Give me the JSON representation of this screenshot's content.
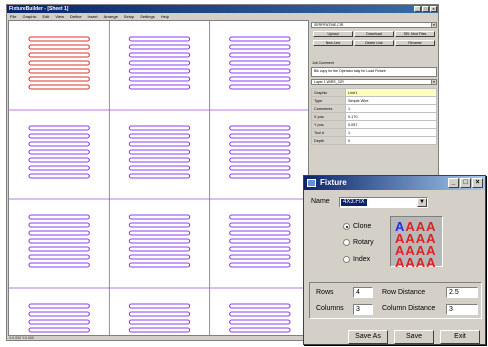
{
  "main_window": {
    "title": "FixtureBuilder - [Sheet 1]",
    "menu": [
      "File",
      "Graphic",
      "Edit",
      "View",
      "Define",
      "Insert",
      "Arrange",
      "Setup",
      "Settings",
      "Help"
    ],
    "status": "X:0.000 Y:0.000"
  },
  "right_panel": {
    "top_combo": "SERPENTINE.CIR",
    "buttons_row1": [
      "Upload",
      "Download",
      "SEL Mod Files"
    ],
    "buttons_row2": [
      "New Line",
      "Delete Line",
      "Rename"
    ],
    "comment_label": "Job Comment",
    "comment_text": "Blk copy for the Operator stay for Load Fixture",
    "layer_combo": "Layer 1  WIRE_CIR",
    "properties": [
      {
        "key": "Graphic",
        "value": "Line1",
        "selected": true
      },
      {
        "key": "Type",
        "value": "Simple Wire",
        "selected": false
      },
      {
        "key": "Comments",
        "value": "1",
        "selected": false
      },
      {
        "key": "X pos",
        "value": "0.170",
        "selected": false
      },
      {
        "key": "Y pos",
        "value": "0.057",
        "selected": false
      },
      {
        "key": "Tool #",
        "value": "1",
        "selected": false
      },
      {
        "key": "Depth",
        "value": "0",
        "selected": false
      }
    ]
  },
  "fixture_dialog": {
    "title": "Fixture",
    "name_label": "Name",
    "name_value": "4X3.FIX",
    "modes": [
      {
        "label": "Clone",
        "selected": true
      },
      {
        "label": "Rotary",
        "selected": false
      },
      {
        "label": "Index",
        "selected": false
      }
    ],
    "preview_letter": "A",
    "rows_label": "Rows",
    "rows_value": "4",
    "columns_label": "Columns",
    "columns_value": "3",
    "row_distance_label": "Row Distance",
    "row_distance_value": "2.5",
    "column_distance_label": "Column Distance",
    "column_distance_value": "3",
    "save_as_label": "Save As",
    "save_label": "Save",
    "exit_label": "Exit"
  },
  "colors": {
    "grid_line": "#a050d0",
    "active_part": "#e03030",
    "clone_part": "#8a3cf0",
    "title_bar": "#0a246a",
    "preview_first": "#2030e0",
    "preview_rest": "#e02020"
  }
}
